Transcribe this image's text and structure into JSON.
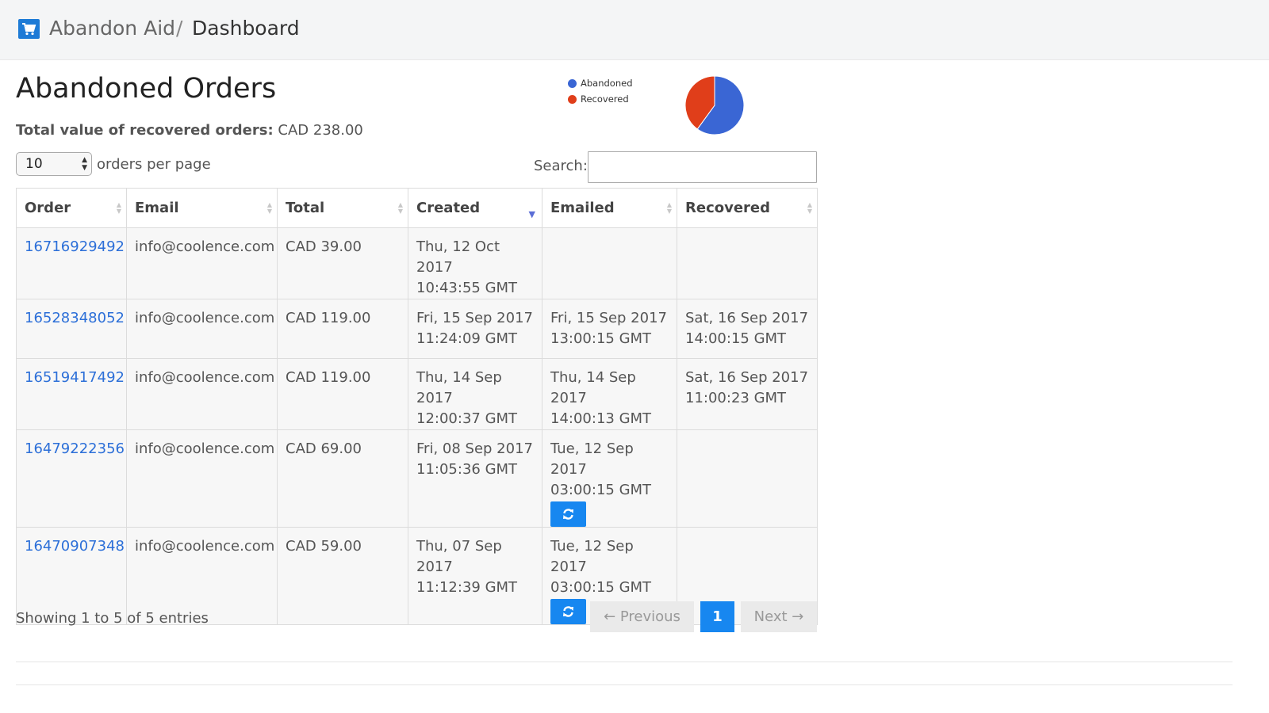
{
  "header": {
    "app_name": "Abandon Aid",
    "separator": "/",
    "current_page": "Dashboard"
  },
  "icons": {
    "logo": "cart-icon",
    "resend": "refresh-icon"
  },
  "page": {
    "title": "Abandoned Orders",
    "summary_label": "Total value of recovered orders:",
    "summary_value": "CAD 238.00"
  },
  "legend": {
    "items": [
      {
        "label": "Abandoned",
        "color": "#3a66d4"
      },
      {
        "label": "Recovered",
        "color": "#e03e1a"
      }
    ]
  },
  "chart_data": {
    "type": "pie",
    "slices": [
      {
        "label": "Abandoned",
        "value": 0.6,
        "color": "#3a66d4"
      },
      {
        "label": "Recovered",
        "value": 0.4,
        "color": "#e03e1a"
      }
    ],
    "legend_placement": "left"
  },
  "controls": {
    "per_page_value": "10",
    "per_page_label": "orders per page",
    "search_label": "Search:",
    "search_value": "",
    "search_placeholder": ""
  },
  "table": {
    "columns": [
      "Order",
      "Email",
      "Total",
      "Created",
      "Emailed",
      "Recovered"
    ],
    "sorted_column": "Created",
    "rows": [
      {
        "order": "16716929492",
        "email": "info@coolence.com",
        "total": "CAD 39.00",
        "created": [
          "Thu, 12 Oct 2017",
          "10:43:55 GMT"
        ],
        "emailed": [
          "",
          ""
        ],
        "recovered": [
          "",
          ""
        ]
      },
      {
        "order": "16528348052",
        "email": "info@coolence.com",
        "total": "CAD 119.00",
        "created": [
          "Fri, 15 Sep 2017",
          "11:24:09 GMT"
        ],
        "emailed": [
          "Fri, 15 Sep 2017",
          "13:00:15 GMT"
        ],
        "recovered": [
          "Sat, 16 Sep 2017",
          "14:00:15 GMT"
        ]
      },
      {
        "order": "16519417492",
        "email": "info@coolence.com",
        "total": "CAD 119.00",
        "created": [
          "Thu, 14 Sep 2017",
          "12:00:37 GMT"
        ],
        "emailed": [
          "Thu, 14 Sep 2017",
          "14:00:13 GMT"
        ],
        "recovered": [
          "Sat, 16 Sep 2017",
          "11:00:23 GMT"
        ]
      },
      {
        "order": "16479222356",
        "email": "info@coolence.com",
        "total": "CAD 69.00",
        "created": [
          "Fri, 08 Sep 2017",
          "11:05:36 GMT"
        ],
        "emailed": [
          "Tue, 12 Sep 2017",
          "03:00:15 GMT"
        ],
        "recovered": [
          "",
          ""
        ]
      },
      {
        "order": "16470907348",
        "email": "info@coolence.com",
        "total": "CAD 59.00",
        "created": [
          "Thu, 07 Sep 2017",
          "11:12:39 GMT"
        ],
        "emailed": [
          "Tue, 12 Sep 2017",
          "03:00:15 GMT"
        ],
        "recovered": [
          "",
          ""
        ]
      }
    ]
  },
  "footer": {
    "info": "Showing 1 to 5 of 5 entries",
    "prev_label": "← Previous",
    "current_page": "1",
    "next_label": "Next →"
  }
}
